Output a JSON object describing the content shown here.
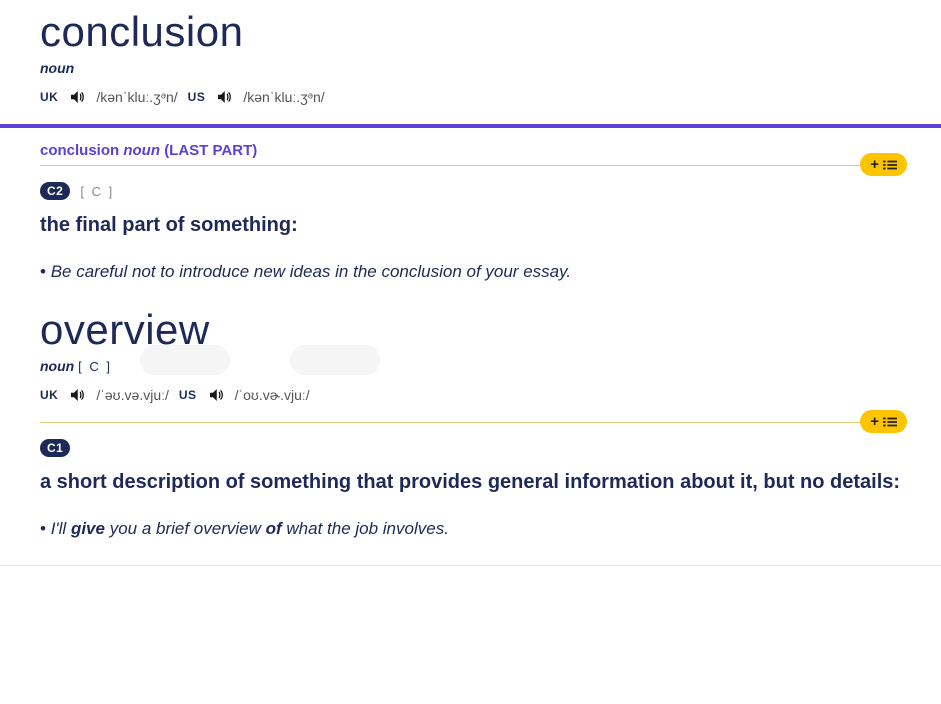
{
  "entries": [
    {
      "headword": "conclusion",
      "pos": "noun",
      "gram_inline": "",
      "pron": {
        "uk_label": "UK",
        "uk_ipa": "/kənˈkluː.ʒᵊn/",
        "us_label": "US",
        "us_ipa": "/kənˈkluː.ʒᵊn/"
      },
      "sense_header": {
        "word": "conclusion",
        "pos": "noun",
        "guide": "(LAST PART)"
      },
      "level": "C2",
      "gram_code": "[ C ]",
      "definition": "the final part of something:",
      "example_plain": "Be careful not to introduce new ideas in the conclusion of your essay."
    },
    {
      "headword": "overview",
      "pos": "noun",
      "gram_inline": "[ C ]",
      "pron": {
        "uk_label": "UK",
        "uk_ipa": "/ˈəʊ.və.vjuː/",
        "us_label": "US",
        "us_ipa": "/ˈoʊ.vɚ.vjuː/"
      },
      "level": "C1",
      "gram_code": "",
      "definition": "a short description of something that provides general information about it, but no details:",
      "example_parts": {
        "a": "I'll ",
        "b": "give",
        "c": " you a brief overview ",
        "d": "of",
        "e": " what the job involves."
      }
    }
  ],
  "add_button": {
    "plus": "+"
  }
}
